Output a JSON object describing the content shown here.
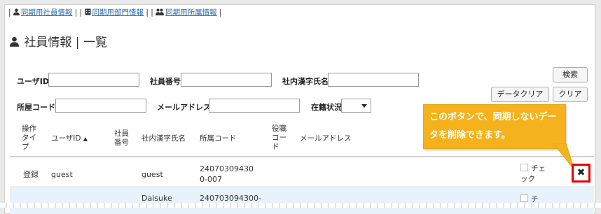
{
  "topnav": {
    "items": [
      {
        "label": "同期用社員情報",
        "icon": "user-icon"
      },
      {
        "label": "同期用部門情報",
        "icon": "building-icon"
      },
      {
        "label": "同期用所属情報",
        "icon": "users-icon"
      }
    ],
    "separator": "|"
  },
  "page": {
    "title": "社員情報 | 一覧",
    "title_icon": "user-icon"
  },
  "search": {
    "user_id_label": "ユーザID",
    "user_id_value": "",
    "employee_no_label": "社員番号",
    "employee_no_value": "",
    "kanji_name_label": "社内漢字氏名",
    "kanji_name_value": "",
    "dept_code_label": "所屋コード",
    "dept_code_value": "",
    "email_label": "メールアドレス",
    "email_value": "",
    "status_label": "在籍状況",
    "status_value": "",
    "search_button": "検索",
    "data_clear_button": "データクリア",
    "clear_button": "クリア"
  },
  "table": {
    "headers": {
      "op_type": "操作タイプ",
      "user_id": "ユーザID",
      "sort_indicator": "▲",
      "employee_no": "社員番号",
      "kanji_name": "社内漢字氏名",
      "dept_code": "所属コード",
      "position_code": "役職コード",
      "email": "メールアドレス"
    },
    "rows": [
      {
        "op_type": "登録",
        "user_id": "guest",
        "employee_no": "",
        "kanji_name": "guest",
        "dept_code": "240703094300-007",
        "position_code": "",
        "email": "",
        "check": "チェック"
      },
      {
        "op_type": "",
        "user_id": "",
        "employee_no": "",
        "kanji_name": "Daisuke",
        "dept_code": "240703094300-",
        "position_code": "",
        "email": "",
        "check": "チ"
      }
    ]
  },
  "callout": {
    "text": "このボタンで、同期しないデータを削除できます。"
  },
  "delete_button": {
    "symbol": "✖"
  },
  "colors": {
    "callout": "#f5b21d",
    "highlight": "#e60000",
    "link": "#2a6cb0",
    "row_alt": "#e7f2fb"
  }
}
